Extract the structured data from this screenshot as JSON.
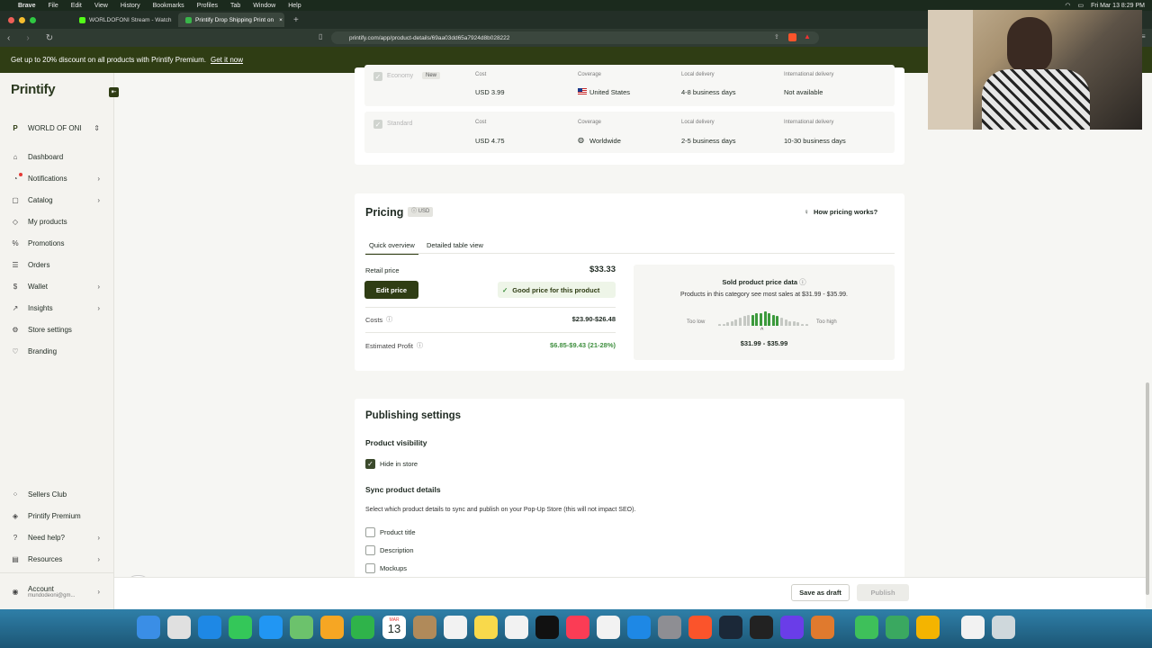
{
  "menubar": {
    "items": [
      "Brave",
      "File",
      "Edit",
      "View",
      "History",
      "Bookmarks",
      "Profiles",
      "Tab",
      "Window",
      "Help"
    ],
    "clock": "Fri Mar 13  8:29 PM"
  },
  "tabs": [
    {
      "label": "WORLDOFONI Stream - Watch",
      "active": false
    },
    {
      "label": "Printify Drop Shipping Print on",
      "active": true
    }
  ],
  "address_bar": {
    "url": "printify.com/app/product-details/69aa03dd65a7924d8b028222"
  },
  "promo": {
    "text": "Get up to 20% discount on all products with Printify Premium.",
    "link": "Get it now"
  },
  "sidebar": {
    "logo": "Printify",
    "store": "WORLD OF ONI",
    "items": [
      {
        "label": "Dashboard",
        "icon": "home-icon"
      },
      {
        "label": "Notifications",
        "icon": "bell-icon"
      },
      {
        "label": "Catalog",
        "icon": "book-icon"
      },
      {
        "label": "My products",
        "icon": "tag-icon"
      },
      {
        "label": "Promotions",
        "icon": "percent-icon"
      },
      {
        "label": "Orders",
        "icon": "list-icon"
      },
      {
        "label": "Wallet",
        "icon": "dollar-icon"
      },
      {
        "label": "Insights",
        "icon": "chart-icon"
      },
      {
        "label": "Store settings",
        "icon": "gear-icon"
      },
      {
        "label": "Branding",
        "icon": "heart-icon"
      }
    ],
    "bottom_items": [
      {
        "label": "Sellers Club",
        "icon": "dots-icon"
      },
      {
        "label": "Printify Premium",
        "icon": "premium-icon"
      },
      {
        "label": "Need help?",
        "icon": "help-icon"
      },
      {
        "label": "Resources",
        "icon": "resources-icon"
      }
    ],
    "account": {
      "label": "Account",
      "email": "mundodeoni@gm..."
    }
  },
  "shipping": {
    "rows": [
      {
        "name": "Economy",
        "badge": "New",
        "cost_label": "Cost",
        "cost": "USD 3.99",
        "coverage_label": "Coverage",
        "coverage": "United States",
        "local_label": "Local delivery",
        "local": "4-8 business days",
        "intl_label": "International delivery",
        "intl": "Not available"
      },
      {
        "name": "Standard",
        "badge": "",
        "cost_label": "Cost",
        "cost": "USD 4.75",
        "coverage_label": "Coverage",
        "coverage": "Worldwide",
        "local_label": "Local delivery",
        "local": "2-5 business days",
        "intl_label": "International delivery",
        "intl": "10-30 business days"
      }
    ]
  },
  "pricing": {
    "title": "Pricing",
    "currency": "USD",
    "how_link": "How pricing works?",
    "tabs": [
      "Quick overview",
      "Detailed table view"
    ],
    "retail_label": "Retail price",
    "retail_value": "$33.33",
    "edit_button": "Edit price",
    "good_price": "Good price for this product",
    "costs_label": "Costs",
    "costs_value": "$23.90-$26.48",
    "profit_label": "Estimated Profit",
    "profit_value": "$6.85-$9.43 (21-28%)",
    "sold_title": "Sold product price data",
    "sold_desc": "Products in this category see most sales at $31.99 - $35.99.",
    "too_low": "Too low",
    "too_high": "Too high",
    "range": "$31.99 - $35.99",
    "histogram": [
      1,
      1,
      2,
      3,
      4,
      5,
      6,
      7,
      7,
      8,
      8,
      9,
      8,
      7,
      6,
      5,
      4,
      3,
      3,
      2,
      1,
      1
    ]
  },
  "publishing": {
    "title": "Publishing settings",
    "visibility_title": "Product visibility",
    "hide_label": "Hide in store",
    "sync_title": "Sync product details",
    "sync_desc": "Select which product details to sync and publish on your Pop-Up Store (this will not impact SEO).",
    "sync_items": [
      "Product title",
      "Description",
      "Mockups"
    ]
  },
  "footer": {
    "save_draft": "Save as draft",
    "publish": "Publish"
  },
  "dock_calendar": {
    "month": "MAR",
    "day": "13"
  },
  "colors": {
    "brand_dark": "#2f3d14",
    "green_good": "#3f8f3f",
    "highlight_bar": "#3c9a3c"
  }
}
